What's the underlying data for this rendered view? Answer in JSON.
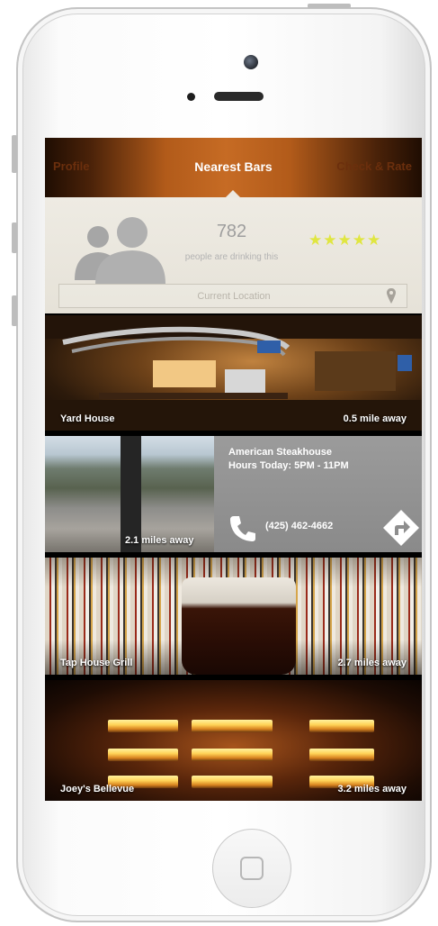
{
  "nav": {
    "left": "Profile",
    "title": "Nearest Bars",
    "right": "Check & Rate"
  },
  "summary": {
    "count": "782",
    "caption": "people are drinking this",
    "stars": "★★★★★",
    "rating": 5
  },
  "location": {
    "placeholder": "Current Location"
  },
  "bars": [
    {
      "name": "Yard House",
      "distance": "0.5 mile away"
    },
    {
      "name": "American Steakhouse",
      "hours": "Hours Today: 5PM - 11PM",
      "phone": "(425) 462-4662",
      "distance": "2.1 miles away"
    },
    {
      "name": "Tap House Grill",
      "distance": "2.7 miles away"
    },
    {
      "name": "Joey's Bellevue",
      "distance": "3.2 miles away"
    }
  ],
  "colors": {
    "nav_orange": "#c66b24",
    "star_yellow": "#e0e640",
    "panel_gray": "#8e8e8e"
  },
  "icons": [
    "avatar-group-icon",
    "location-pin-icon",
    "phone-icon",
    "directions-icon",
    "home-square-icon"
  ]
}
